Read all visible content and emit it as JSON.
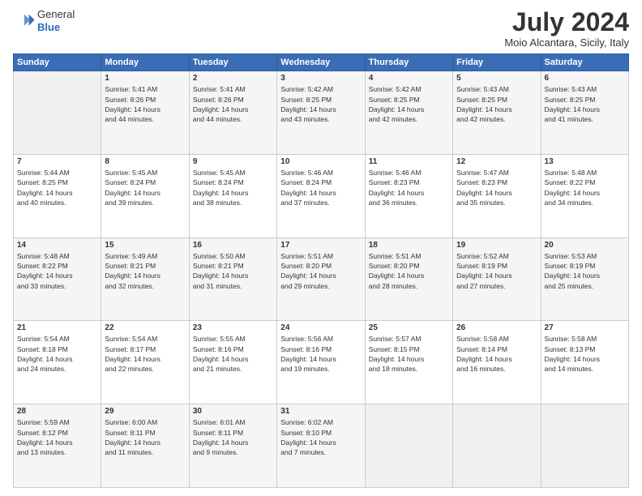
{
  "logo": {
    "line1": "General",
    "line2": "Blue"
  },
  "header": {
    "title": "July 2024",
    "subtitle": "Moio Alcantara, Sicily, Italy"
  },
  "weekdays": [
    "Sunday",
    "Monday",
    "Tuesday",
    "Wednesday",
    "Thursday",
    "Friday",
    "Saturday"
  ],
  "weeks": [
    [
      {
        "day": "",
        "info": ""
      },
      {
        "day": "1",
        "info": "Sunrise: 5:41 AM\nSunset: 8:26 PM\nDaylight: 14 hours\nand 44 minutes."
      },
      {
        "day": "2",
        "info": "Sunrise: 5:41 AM\nSunset: 8:26 PM\nDaylight: 14 hours\nand 44 minutes."
      },
      {
        "day": "3",
        "info": "Sunrise: 5:42 AM\nSunset: 8:25 PM\nDaylight: 14 hours\nand 43 minutes."
      },
      {
        "day": "4",
        "info": "Sunrise: 5:42 AM\nSunset: 8:25 PM\nDaylight: 14 hours\nand 42 minutes."
      },
      {
        "day": "5",
        "info": "Sunrise: 5:43 AM\nSunset: 8:25 PM\nDaylight: 14 hours\nand 42 minutes."
      },
      {
        "day": "6",
        "info": "Sunrise: 5:43 AM\nSunset: 8:25 PM\nDaylight: 14 hours\nand 41 minutes."
      }
    ],
    [
      {
        "day": "7",
        "info": "Sunrise: 5:44 AM\nSunset: 8:25 PM\nDaylight: 14 hours\nand 40 minutes."
      },
      {
        "day": "8",
        "info": "Sunrise: 5:45 AM\nSunset: 8:24 PM\nDaylight: 14 hours\nand 39 minutes."
      },
      {
        "day": "9",
        "info": "Sunrise: 5:45 AM\nSunset: 8:24 PM\nDaylight: 14 hours\nand 38 minutes."
      },
      {
        "day": "10",
        "info": "Sunrise: 5:46 AM\nSunset: 8:24 PM\nDaylight: 14 hours\nand 37 minutes."
      },
      {
        "day": "11",
        "info": "Sunrise: 5:46 AM\nSunset: 8:23 PM\nDaylight: 14 hours\nand 36 minutes."
      },
      {
        "day": "12",
        "info": "Sunrise: 5:47 AM\nSunset: 8:23 PM\nDaylight: 14 hours\nand 35 minutes."
      },
      {
        "day": "13",
        "info": "Sunrise: 5:48 AM\nSunset: 8:22 PM\nDaylight: 14 hours\nand 34 minutes."
      }
    ],
    [
      {
        "day": "14",
        "info": "Sunrise: 5:48 AM\nSunset: 8:22 PM\nDaylight: 14 hours\nand 33 minutes."
      },
      {
        "day": "15",
        "info": "Sunrise: 5:49 AM\nSunset: 8:21 PM\nDaylight: 14 hours\nand 32 minutes."
      },
      {
        "day": "16",
        "info": "Sunrise: 5:50 AM\nSunset: 8:21 PM\nDaylight: 14 hours\nand 31 minutes."
      },
      {
        "day": "17",
        "info": "Sunrise: 5:51 AM\nSunset: 8:20 PM\nDaylight: 14 hours\nand 29 minutes."
      },
      {
        "day": "18",
        "info": "Sunrise: 5:51 AM\nSunset: 8:20 PM\nDaylight: 14 hours\nand 28 minutes."
      },
      {
        "day": "19",
        "info": "Sunrise: 5:52 AM\nSunset: 8:19 PM\nDaylight: 14 hours\nand 27 minutes."
      },
      {
        "day": "20",
        "info": "Sunrise: 5:53 AM\nSunset: 8:19 PM\nDaylight: 14 hours\nand 25 minutes."
      }
    ],
    [
      {
        "day": "21",
        "info": "Sunrise: 5:54 AM\nSunset: 8:18 PM\nDaylight: 14 hours\nand 24 minutes."
      },
      {
        "day": "22",
        "info": "Sunrise: 5:54 AM\nSunset: 8:17 PM\nDaylight: 14 hours\nand 22 minutes."
      },
      {
        "day": "23",
        "info": "Sunrise: 5:55 AM\nSunset: 8:16 PM\nDaylight: 14 hours\nand 21 minutes."
      },
      {
        "day": "24",
        "info": "Sunrise: 5:56 AM\nSunset: 8:16 PM\nDaylight: 14 hours\nand 19 minutes."
      },
      {
        "day": "25",
        "info": "Sunrise: 5:57 AM\nSunset: 8:15 PM\nDaylight: 14 hours\nand 18 minutes."
      },
      {
        "day": "26",
        "info": "Sunrise: 5:58 AM\nSunset: 8:14 PM\nDaylight: 14 hours\nand 16 minutes."
      },
      {
        "day": "27",
        "info": "Sunrise: 5:58 AM\nSunset: 8:13 PM\nDaylight: 14 hours\nand 14 minutes."
      }
    ],
    [
      {
        "day": "28",
        "info": "Sunrise: 5:59 AM\nSunset: 8:12 PM\nDaylight: 14 hours\nand 13 minutes."
      },
      {
        "day": "29",
        "info": "Sunrise: 6:00 AM\nSunset: 8:11 PM\nDaylight: 14 hours\nand 11 minutes."
      },
      {
        "day": "30",
        "info": "Sunrise: 6:01 AM\nSunset: 8:11 PM\nDaylight: 14 hours\nand 9 minutes."
      },
      {
        "day": "31",
        "info": "Sunrise: 6:02 AM\nSunset: 8:10 PM\nDaylight: 14 hours\nand 7 minutes."
      },
      {
        "day": "",
        "info": ""
      },
      {
        "day": "",
        "info": ""
      },
      {
        "day": "",
        "info": ""
      }
    ]
  ]
}
